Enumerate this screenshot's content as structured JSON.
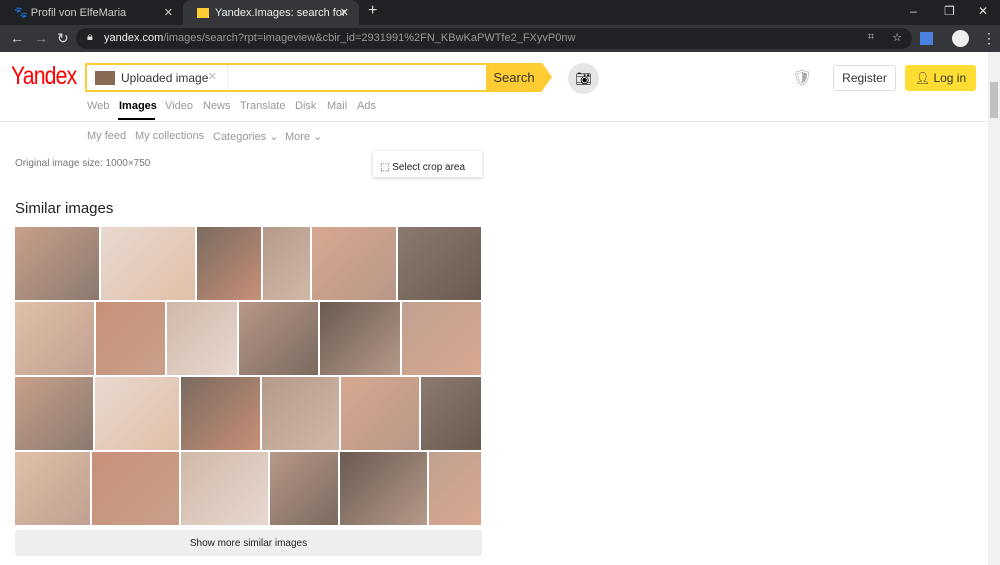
{
  "browser": {
    "tabs": [
      {
        "title": "Profil von ElfeMaria",
        "icon": "paw-icon"
      },
      {
        "title": "Yandex.Images: search for image",
        "icon": "yandex-images-icon"
      }
    ],
    "url_host": "yandex.com",
    "url_path": "/images/search?rpt=imageview&cbir_id=2931991%2FN_KBwKaPWTfe2_FXyvP0nw"
  },
  "header": {
    "logo": "Yandex",
    "search_value": "Uploaded image",
    "search_button": "Search",
    "register": "Register",
    "login": "Log in"
  },
  "nav": [
    "Web",
    "Images",
    "Video",
    "News",
    "Translate",
    "Disk",
    "Mail",
    "Ads"
  ],
  "subnav": [
    "My feed",
    "My collections",
    "Categories",
    "More"
  ],
  "main": {
    "original_size": "Original image size: 1000×750",
    "crop_button": "Select crop area",
    "similar_title": "Similar images",
    "show_more": "Show more similar images",
    "similar_image_count": 24
  },
  "colors": {
    "accent": "#ffcc33",
    "login": "#ffdd33",
    "logo_y": "#ff0000"
  }
}
